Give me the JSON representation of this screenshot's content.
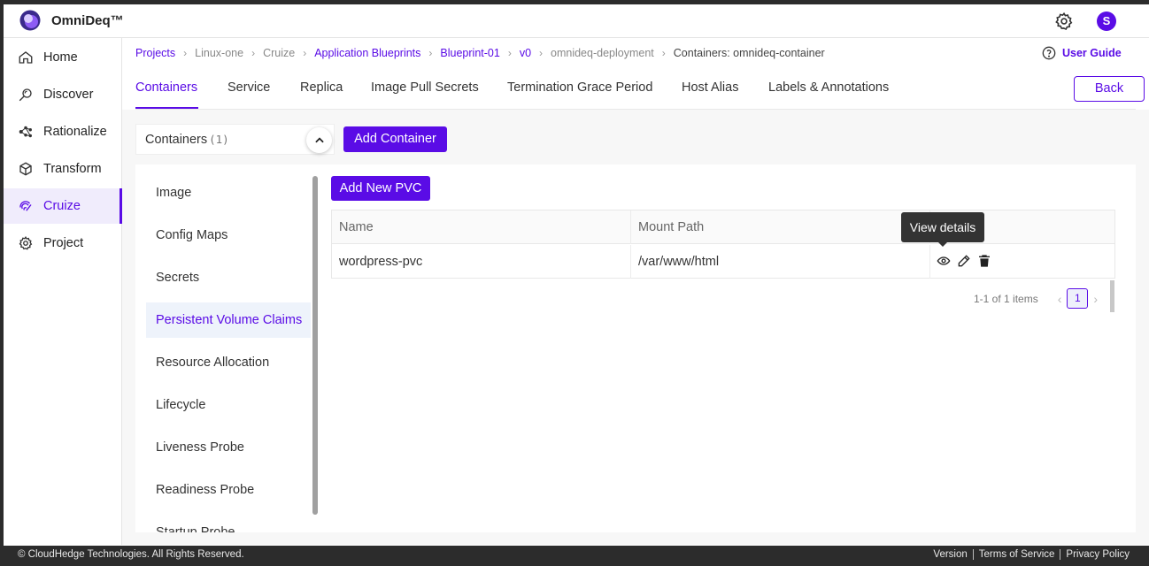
{
  "app": {
    "brand": "OmniDeq™",
    "avatar_letter": "S",
    "accent": "#5a0ce6"
  },
  "sidebar": {
    "items": [
      {
        "label": "Home",
        "icon": "home-icon"
      },
      {
        "label": "Discover",
        "icon": "discover-icon"
      },
      {
        "label": "Rationalize",
        "icon": "rationalize-icon"
      },
      {
        "label": "Transform",
        "icon": "transform-icon"
      },
      {
        "label": "Cruize",
        "icon": "cruize-icon",
        "active": true
      },
      {
        "label": "Project",
        "icon": "project-gear-icon"
      }
    ]
  },
  "breadcrumb": [
    {
      "label": "Projects",
      "style": "link"
    },
    {
      "label": "Linux-one",
      "style": "muted"
    },
    {
      "label": "Cruize",
      "style": "muted"
    },
    {
      "label": "Application Blueprints",
      "style": "link"
    },
    {
      "label": "Blueprint-01",
      "style": "link"
    },
    {
      "label": "v0",
      "style": "link"
    },
    {
      "label": "omnideq-deployment",
      "style": "muted"
    },
    {
      "label": "Containers: omnideq-container",
      "style": "current"
    }
  ],
  "user_guide": "User Guide",
  "tabs": [
    {
      "label": "Containers",
      "active": true
    },
    {
      "label": "Service"
    },
    {
      "label": "Replica"
    },
    {
      "label": "Image Pull Secrets"
    },
    {
      "label": "Termination Grace Period"
    },
    {
      "label": "Host Alias"
    },
    {
      "label": "Labels & Annotations"
    }
  ],
  "back_label": "Back",
  "containers": {
    "label": "Containers",
    "count": "(1)",
    "add_label": "Add Container"
  },
  "subnav": [
    {
      "label": "Image"
    },
    {
      "label": "Config Maps"
    },
    {
      "label": "Secrets"
    },
    {
      "label": "Persistent Volume Claims",
      "active": true
    },
    {
      "label": "Resource Allocation"
    },
    {
      "label": "Lifecycle"
    },
    {
      "label": "Liveness Probe"
    },
    {
      "label": "Readiness Probe"
    },
    {
      "label": "Startup Probe"
    }
  ],
  "pvc": {
    "add_label": "Add New PVC",
    "columns": [
      "Name",
      "Mount Path",
      ""
    ],
    "rows": [
      {
        "name": "wordpress-pvc",
        "mount_path": "/var/www/html"
      }
    ],
    "tooltip": "View details",
    "pager": {
      "range": "1-1 of 1 items",
      "page": "1"
    }
  },
  "footer": {
    "copyright": "© CloudHedge Technologies. All Rights Reserved.",
    "links": [
      "Version",
      "Terms of Service",
      "Privacy Policy"
    ]
  }
}
